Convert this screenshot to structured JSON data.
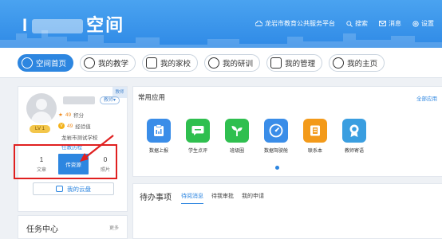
{
  "header": {
    "brand_prefix": "I",
    "brand_suffix": "空间",
    "links": [
      {
        "icon": "cloud-icon",
        "label": "龙岩市教育公共服务平台"
      },
      {
        "icon": "search-icon",
        "label": "搜索"
      },
      {
        "icon": "mail-icon",
        "label": "消息"
      },
      {
        "icon": "gear-icon",
        "label": "设置"
      }
    ]
  },
  "nav": {
    "tabs": [
      {
        "label": "空间首页",
        "icon": "user-icon",
        "active": true
      },
      {
        "label": "我的教学",
        "icon": "chat-icon"
      },
      {
        "label": "我的家校",
        "icon": "monitor-icon"
      },
      {
        "label": "我的研训",
        "icon": "discussion-icon"
      },
      {
        "label": "我的管理",
        "icon": "document-icon"
      },
      {
        "label": "我的主页",
        "icon": "home-icon"
      }
    ]
  },
  "profile": {
    "corner_badge": "教师",
    "role": "教师▾",
    "level": "LV 1",
    "points_value": "49",
    "points_label": "积分",
    "exp_value": "49",
    "exp_label": "经验值",
    "school": "龙岩市测试学校",
    "trust": "任教历程",
    "articles_count": "1",
    "articles_label": "文章",
    "resources_label": "传资源",
    "photos_count": "0",
    "photos_label": "照片",
    "cloud_label": "我的云盘"
  },
  "tasks": {
    "title": "任务中心",
    "more": "更多"
  },
  "apps": {
    "title": "常用应用",
    "all": "全部应用",
    "items": [
      {
        "label": "数据上报",
        "color": "#3a8de8",
        "icon": "report-icon"
      },
      {
        "label": "学生点评",
        "color": "#2fbf4f",
        "icon": "comment-icon"
      },
      {
        "label": "班级圈",
        "color": "#2fbf4f",
        "icon": "sprout-icon"
      },
      {
        "label": "数据驾驶舱",
        "color": "#3a8de8",
        "icon": "gauge-icon"
      },
      {
        "label": "联系本",
        "color": "#f39a1a",
        "icon": "contact-book-icon"
      },
      {
        "label": "教师寄语",
        "color": "#3a9ee0",
        "icon": "medal-icon"
      }
    ]
  },
  "todo": {
    "title": "待办事项",
    "tabs": [
      "待阅消息",
      "待我审批",
      "我的申请"
    ]
  },
  "colors": {
    "accent": "#2d86e0",
    "highlight": "#e02020"
  }
}
